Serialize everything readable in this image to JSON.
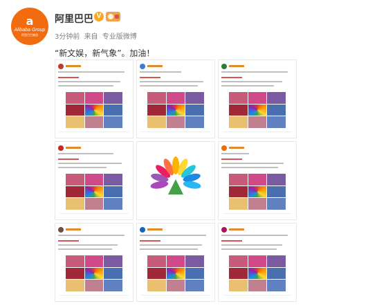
{
  "profile": {
    "avatar_glyph": "a",
    "avatar_brand": "Alibaba Group",
    "avatar_sub": "阿里巴巴集团",
    "name": "阿里巴巴",
    "verified_mark": "V"
  },
  "meta": {
    "time": "3分钟前",
    "source_prefix": "来自",
    "source": "专业版微博"
  },
  "post": {
    "text": "“新文娱，新气象”。加油！"
  },
  "icons": {
    "verified": "verified-badge-icon",
    "member": "member-badge-icon"
  },
  "colors": {
    "brand": "#f26b0f",
    "verified": "#f9a825"
  }
}
